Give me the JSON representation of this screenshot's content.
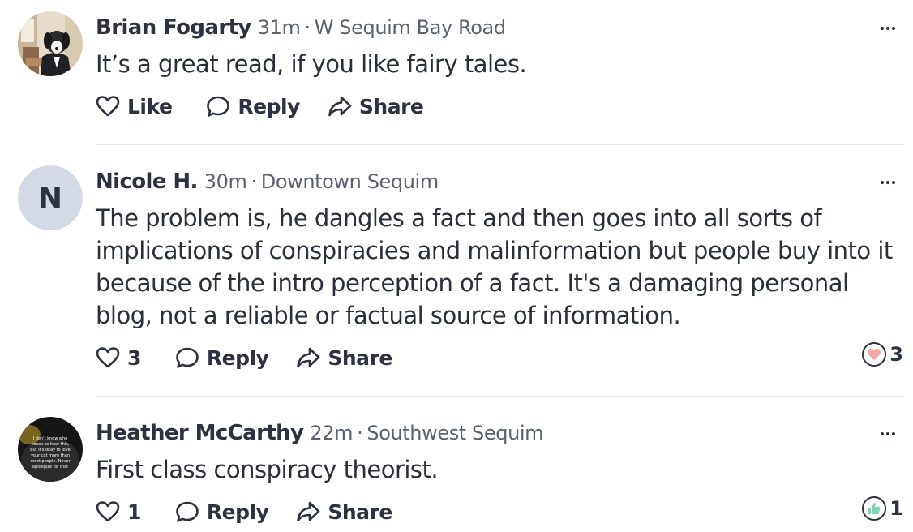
{
  "comments": [
    {
      "author": "Brian Fogarty",
      "time": "31m",
      "location": "W Sequim Bay Road",
      "text": "It’s a great read, if you like fairy tales.",
      "like_label": "Like",
      "reply_label": "Reply",
      "share_label": "Share",
      "avatar_icon": "dog-in-suit-photo"
    },
    {
      "author": "Nicole H.",
      "time": "30m",
      "location": "Downtown Sequim",
      "avatar_letter": "N",
      "avatar_color": "#d4d9e6",
      "text": "The problem is, he dangles a fact and then goes into all sorts of implications of conspiracies and malinformation but people buy into it because of the intro perception of a fact. It's a damaging personal blog, not a reliable or factual source of information.",
      "like_label": "3",
      "reply_label": "Reply",
      "share_label": "Share",
      "reaction_icon": "heart-icon",
      "reaction_color": "#f7a6a8",
      "reaction_count": "3"
    },
    {
      "author": "Heather McCarthy",
      "time": "22m",
      "location": "Southwest Sequim",
      "text": "First class conspiracy theorist.",
      "like_label": "1",
      "reply_label": "Reply",
      "share_label": "Share",
      "avatar_icon": "cat-with-text-photo",
      "avatar_lettering": "I don't know who needs to hear this, but it's okay to love your cat more than most people. Never apologize for that",
      "reaction_icon": "thumbs-up-icon",
      "reaction_color": "#7fd4b6",
      "reaction_count": "1"
    }
  ]
}
